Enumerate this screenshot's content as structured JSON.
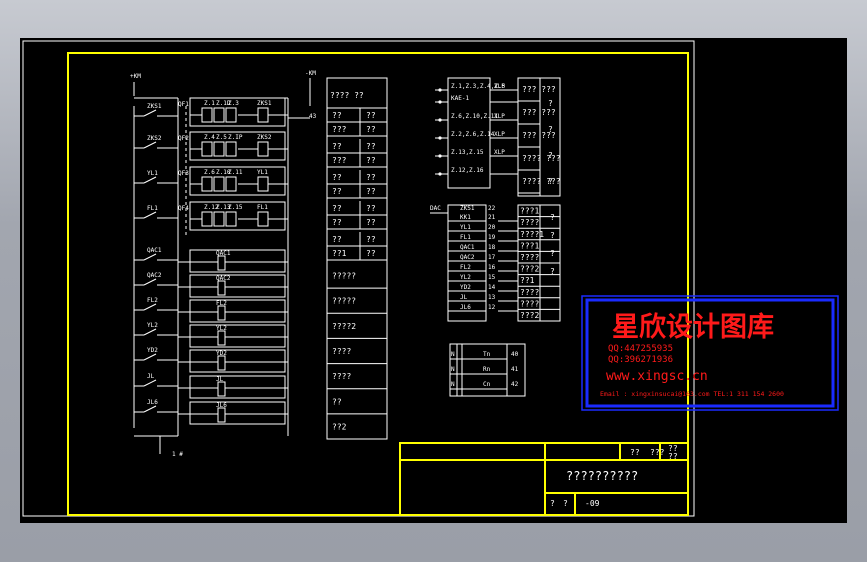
{
  "colors": {
    "frame": "#ffff00",
    "lines": "#ffffff",
    "watermark": "#ff1a1a",
    "watermark_border": "#1a2bff",
    "canvas": "#000000"
  },
  "watermark": {
    "title": "星欣设计图库",
    "qq1": "QQ:447255935",
    "qq2": "QQ:396271936",
    "url": "www.xingsc.cn",
    "contact": "Email : xingxinsucai@163.com   TEL:1 311 154 2600"
  },
  "title_block": {
    "hdr1": "??",
    "hdr2": "???",
    "hdr3": "??",
    "hdr3b": "??",
    "drawing_title": "??????????",
    "footer_a": "?",
    "footer_b": "?",
    "footer_num": "-09"
  },
  "left_labels": {
    "supply_top": "+KM",
    "supply_top2": "-KM",
    "bottom_caption": "1 #",
    "contacts": [
      "ZKS1",
      "ZKS2",
      "YL1",
      "FL1",
      "QAC1",
      "QAC2",
      "FL2",
      "YL2",
      "YD2",
      "JL",
      "JL6"
    ],
    "box_tags": [
      "QF1",
      "QF2",
      "QF3",
      "QF4"
    ],
    "rows": [
      [
        "Z.1",
        "Z.1D",
        "Z.3",
        "ZKS1"
      ],
      [
        "Z.4",
        "Z.5",
        "Z.IP",
        "ZKS2"
      ],
      [
        "Z.6",
        "Z.10",
        "Z.11",
        "YL1"
      ],
      [
        "Z.12",
        "Z.13",
        "Z.15",
        "FL1"
      ]
    ],
    "coil_labels": [
      "QAC1",
      "QAC2",
      "FL2",
      "YL2",
      "YD2",
      "JL",
      "JL6"
    ],
    "right_tag": "43",
    "supply_right": "-KM"
  },
  "table_mid": {
    "header": "???? ??",
    "rows": [
      [
        "??",
        "??"
      ],
      [
        "???",
        "??"
      ],
      [
        "??",
        "??"
      ],
      [
        "???",
        "??"
      ],
      [
        "??",
        "??"
      ],
      [
        "??",
        "??"
      ],
      [
        "??",
        "??"
      ],
      [
        "??",
        "??"
      ],
      [
        "??",
        "??"
      ],
      [
        "??1",
        "??"
      ]
    ],
    "single_rows": [
      "?????",
      "?????",
      "????2",
      "????",
      "????",
      "??",
      "??2"
    ]
  },
  "right_top": {
    "items": [
      "Z.1,Z.3,Z.4,Z.5",
      "KAE-1",
      "Z.6,Z.10,Z.11",
      "Z.2,Z.6,Z.14",
      "Z.13,Z.15",
      "Z.12,Z.16"
    ],
    "tags": [
      "XLP",
      "XLP",
      "XLP",
      "XLP"
    ],
    "table": [
      "???\n???",
      "???\n???",
      "???\n???",
      "????\n???",
      "????\n???"
    ],
    "q": [
      "?",
      "?",
      "?",
      "?"
    ]
  },
  "right_mid": {
    "header_left": "DAC",
    "header_mid": "ZKS1",
    "header_right": "22",
    "rows": [
      [
        "KK1",
        "21"
      ],
      [
        "YL1",
        "20"
      ],
      [
        "FL1",
        "19"
      ],
      [
        "QAC1",
        "18"
      ],
      [
        "QAC2",
        "17"
      ],
      [
        "FL2",
        "16"
      ],
      [
        "YL2",
        "15"
      ],
      [
        "YD2",
        "14"
      ],
      [
        "JL",
        "13"
      ],
      [
        "JL6",
        "12"
      ]
    ],
    "table": [
      "???1",
      "????",
      "????1",
      "???1",
      "????",
      "???2",
      "??1",
      "????",
      "????",
      "???2"
    ],
    "q": [
      "?",
      "?",
      "?",
      "?"
    ]
  },
  "right_bottom": {
    "rows": [
      [
        "Tn",
        "40"
      ],
      [
        "Rn",
        "41"
      ],
      [
        "Cn",
        "42"
      ]
    ],
    "left_tags": [
      "N",
      "N",
      "N"
    ]
  }
}
